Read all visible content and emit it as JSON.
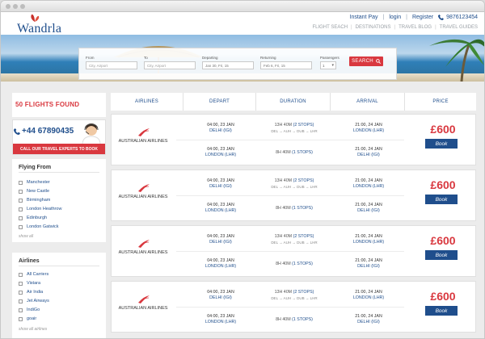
{
  "brand": {
    "logo_text": "Wandrla",
    "accent": "#d9383f",
    "primary": "#1f4e8c"
  },
  "toplinks": {
    "instant_pay": "Instant Pay",
    "login": "login",
    "register": "Register",
    "phone": "9876123454"
  },
  "mainnav": [
    "FLIGHT SEACH",
    "DESTINATIONS",
    "TRAVEL BLOG",
    "TRAVEL GUIDES"
  ],
  "search": {
    "from_label": "From",
    "from_placeholder": "City, Airport",
    "to_label": "To",
    "to_placeholder": "City, Airport",
    "departing_label": "Departing",
    "departing_value": "Jan 30, Fri, 15",
    "returning_label": "Returning",
    "returning_value": "Feb 6, Fri, 15",
    "passengers_label": "Passengers",
    "passengers_value": "1",
    "button": "SEARCH"
  },
  "sidebar": {
    "found": "50 FLIGHTS FOUND",
    "call_number": "+44 67890435",
    "call_cta": "CALL OUR TRAVEL EXPERTS TO BOOK",
    "flying_from": {
      "title": "Flying From",
      "items": [
        "Manchester",
        "New Castle",
        "Birmingham",
        "London Heathrow",
        "Edinburgh",
        "London Gatwick"
      ],
      "show_all": "show all"
    },
    "airlines": {
      "title": "Airlines",
      "items": [
        "All Carriers",
        "Vistara",
        "Air India",
        "Jet Airways",
        "IndiGo",
        "goair"
      ],
      "show_all": "show all airlines"
    }
  },
  "results": {
    "headers": [
      "AIRLINES",
      "DEPART",
      "DURATION",
      "ARRIVAL",
      "PRICE"
    ],
    "items": [
      {
        "airline": "AUSTRALIAN AIRLINES",
        "out": {
          "dep_time": "04:00, 23 JAN",
          "dep_place": "DELHI (IGI)",
          "duration": "13H 40M",
          "stops": "(2 STOPS)",
          "route": "DEL → AUH → DUB → LHR",
          "arr_time": "21:00, 24 JAN",
          "arr_place": "LONDON (LHR)"
        },
        "ret": {
          "dep_time": "04:00, 23 JAN",
          "dep_place": "LONDON (LHR)",
          "duration": "8H 40M",
          "stops": "(1 STOPS)",
          "arr_time": "21:00, 24 JAN",
          "arr_place": "DELHI (IGI)"
        },
        "price": "£600",
        "book": "Book"
      },
      {
        "airline": "AUSTRALIAN AIRLINES",
        "out": {
          "dep_time": "04:00, 23 JAN",
          "dep_place": "DELHI (IGI)",
          "duration": "13H 40M",
          "stops": "(2 STOPS)",
          "route": "DEL → AUH → DUB → LHR",
          "arr_time": "21:00, 24 JAN",
          "arr_place": "LONDON (LHR)"
        },
        "ret": {
          "dep_time": "04:00, 23 JAN",
          "dep_place": "LONDON (LHR)",
          "duration": "8H 40M",
          "stops": "(1 STOPS)",
          "arr_time": "21:00, 24 JAN",
          "arr_place": "DELHI (IGI)"
        },
        "price": "£600",
        "book": "Book"
      },
      {
        "airline": "AUSTRALIAN AIRLINES",
        "out": {
          "dep_time": "04:00, 23 JAN",
          "dep_place": "DELHI (IGI)",
          "duration": "13H 40M",
          "stops": "(2 STOPS)",
          "route": "DEL → AUH → DUB → LHR",
          "arr_time": "21:00, 24 JAN",
          "arr_place": "LONDON (LHR)"
        },
        "ret": {
          "dep_time": "04:00, 23 JAN",
          "dep_place": "LONDON (LHR)",
          "duration": "8H 40M",
          "stops": "(1 STOPS)",
          "arr_time": "21:00, 24 JAN",
          "arr_place": "DELHI (IGI)"
        },
        "price": "£600",
        "book": "Book"
      },
      {
        "airline": "AUSTRALIAN AIRLINES",
        "out": {
          "dep_time": "04:00, 23 JAN",
          "dep_place": "DELHI (IGI)",
          "duration": "13H 40M",
          "stops": "(2 STOPS)",
          "route": "DEL → AUH → DUB → LHR",
          "arr_time": "21:00, 24 JAN",
          "arr_place": "LONDON (LHR)"
        },
        "ret": {
          "dep_time": "04:00, 23 JAN",
          "dep_place": "LONDON (LHR)",
          "duration": "8H 40M",
          "stops": "(1 STOPS)",
          "arr_time": "21:00, 24 JAN",
          "arr_place": "DELHI (IGI)"
        },
        "price": "£600",
        "book": "Book"
      }
    ]
  }
}
